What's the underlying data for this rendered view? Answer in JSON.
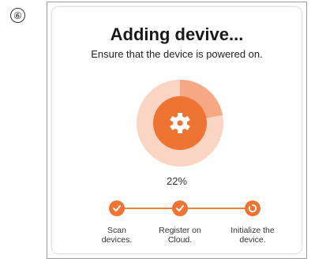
{
  "step_marker": "⑥",
  "dialog": {
    "title": "Adding devive...",
    "subtitle": "Ensure that the device is powered on.",
    "progress": 0.22,
    "progress_label": "22%",
    "center_icon": "gear-icon"
  },
  "steps": [
    {
      "label_line1": "Scan",
      "label_line2": "devices.",
      "status": "done",
      "icon": "check-icon"
    },
    {
      "label_line1": "Register on",
      "label_line2": "Cloud.",
      "status": "done",
      "icon": "check-icon"
    },
    {
      "label_line1": "Initialize the",
      "label_line2": "device.",
      "status": "in-progress",
      "icon": "loading-icon"
    }
  ],
  "colors": {
    "accent": "#ee7434",
    "ring_light": "#fbd5c3",
    "ring_progress": "#f6a784"
  }
}
